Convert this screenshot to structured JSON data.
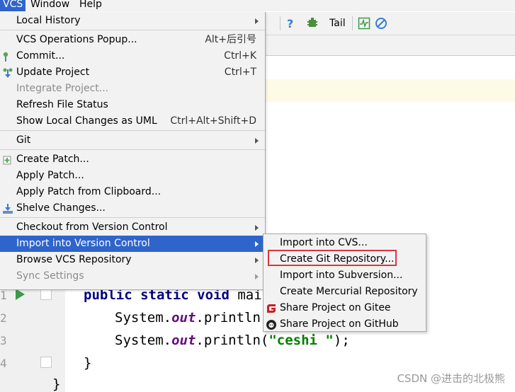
{
  "menubar": {
    "items": [
      {
        "label": "VCS",
        "active": true
      },
      {
        "label": "Window"
      },
      {
        "label": "Help"
      }
    ]
  },
  "toolbar": {
    "tail_label": "Tail",
    "icons": [
      "help-icon",
      "plugin-icon",
      "activity-icon",
      "no-entry-icon"
    ]
  },
  "vcs_menu": {
    "items": [
      {
        "label": "Local History",
        "submenu": true
      },
      {
        "label": "VCS Operations Popup...",
        "shortcut": "Alt+后引号"
      },
      {
        "label": "Commit...",
        "shortcut": "Ctrl+K",
        "icon": "commit-icon"
      },
      {
        "label": "Update Project",
        "shortcut": "Ctrl+T",
        "icon": "update-icon"
      },
      {
        "label": "Integrate Project...",
        "disabled": true
      },
      {
        "label": "Refresh File Status"
      },
      {
        "label": "Show Local Changes as UML",
        "shortcut": "Ctrl+Alt+Shift+D"
      },
      {
        "label": "Git",
        "submenu": true
      },
      {
        "label": "Create Patch...",
        "icon": "patch-icon"
      },
      {
        "label": "Apply Patch..."
      },
      {
        "label": "Apply Patch from Clipboard..."
      },
      {
        "label": "Shelve Changes...",
        "icon": "shelve-icon"
      },
      {
        "label": "Checkout from Version Control",
        "submenu": true
      },
      {
        "label": "Import into Version Control",
        "submenu": true,
        "selected": true
      },
      {
        "label": "Browse VCS Repository",
        "submenu": true
      },
      {
        "label": "Sync Settings",
        "submenu": true,
        "disabled": true
      }
    ]
  },
  "import_submenu": {
    "items": [
      {
        "label": "Import into CVS..."
      },
      {
        "label": "Create Git Repository...",
        "highlighted": true
      },
      {
        "label": "Import into Subversion..."
      },
      {
        "label": "Create Mercurial Repository"
      },
      {
        "label": "Share Project on Gitee",
        "icon": "gitee-icon"
      },
      {
        "label": "Share Project on GitHub",
        "icon": "github-icon"
      }
    ]
  },
  "editor": {
    "line_numbers": [
      "1",
      "2",
      "3",
      "4"
    ],
    "lines": [
      {
        "kw": "public static void",
        "rest": " mai"
      },
      {
        "prefix": "System.",
        "field": "out",
        "mid": ".println("
      },
      {
        "prefix": "System.",
        "field": "out",
        "mid": ".println(",
        "string": "\"ceshi \"",
        "suffix": ");"
      },
      {
        "text": "}"
      },
      {
        "text": "}"
      }
    ]
  },
  "watermark": "CSDN @进击的北极熊",
  "colors": {
    "selection": "#2f65ca",
    "menu_bg": "#f2f2f2",
    "highlight_box": "#d9363e",
    "keyword": "#000080",
    "string": "#008000"
  }
}
